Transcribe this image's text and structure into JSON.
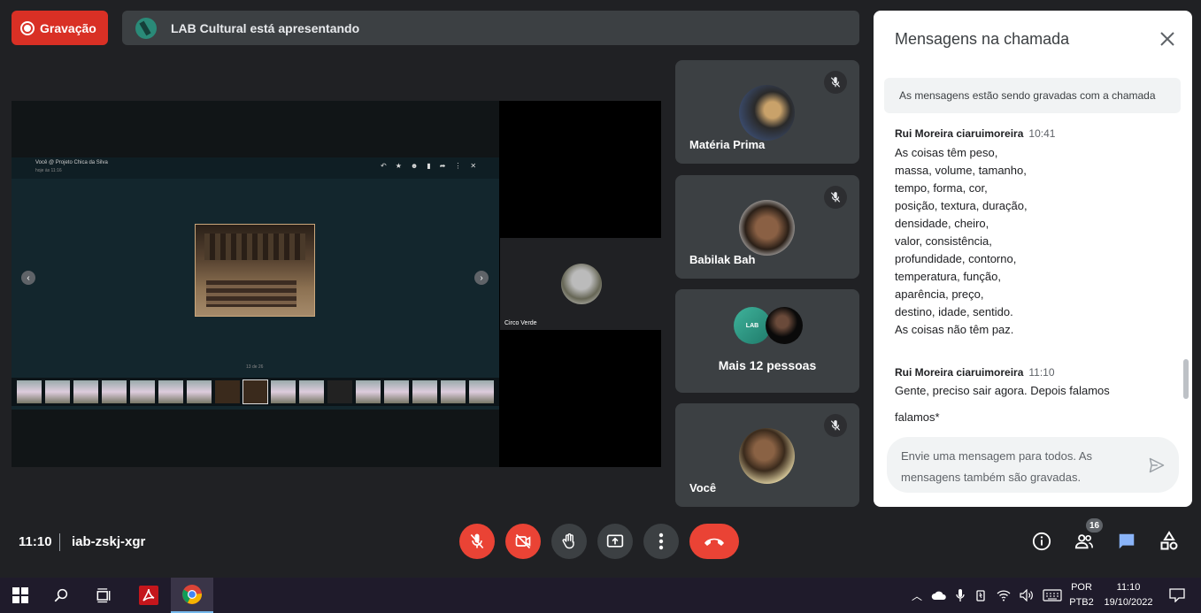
{
  "top": {
    "recording_label": "Gravação",
    "presenting_label": "LAB Cultural está apresentando"
  },
  "shared_screen": {
    "title": "Você @ Projeto Chica da Silva",
    "subtitle": "hoje às 11:16",
    "counter": "13 de 26",
    "side_participant": "Circo Verde"
  },
  "tiles": [
    {
      "name": "Matéria Prima",
      "muted": true
    },
    {
      "name": "Babilak Bah",
      "muted": true
    },
    {
      "name": "Mais 12 pessoas",
      "group_initials": "LAB"
    },
    {
      "name": "Você",
      "muted": true
    }
  ],
  "chat": {
    "title": "Mensagens na chamada",
    "notice": "As mensagens estão sendo gravadas com a chamada",
    "messages": [
      {
        "sender": "Rui Moreira ciaruimoreira",
        "time": "10:41",
        "lines": [
          "As coisas têm peso,",
          "massa, volume, tamanho,",
          "tempo, forma, cor,",
          "posição, textura, duração,",
          "densidade, cheiro,",
          "valor, consistência,",
          "profundidade, contorno,",
          "temperatura, função,",
          "aparência, preço,",
          "destino, idade, sentido.",
          "As coisas não têm paz."
        ]
      },
      {
        "sender": "Rui Moreira ciaruimoreira",
        "time": "11:10",
        "lines": [
          "Gente, preciso sair agora. Depois falamos",
          "falamos*"
        ]
      }
    ],
    "compose_placeholder_line1": "Envie uma mensagem para todos. As",
    "compose_placeholder_line2": "mensagens também são gravadas."
  },
  "bottom": {
    "time": "11:10",
    "meeting_code": "iab-zskj-xgr",
    "participants_count": "16"
  },
  "taskbar": {
    "lang_line1": "POR",
    "lang_line2": "PTB2",
    "time": "11:10",
    "date": "19/10/2022"
  },
  "colors": {
    "background": "#202124",
    "tile": "#3c4043",
    "danger": "#ea4335",
    "accent": "#1a73e8"
  }
}
